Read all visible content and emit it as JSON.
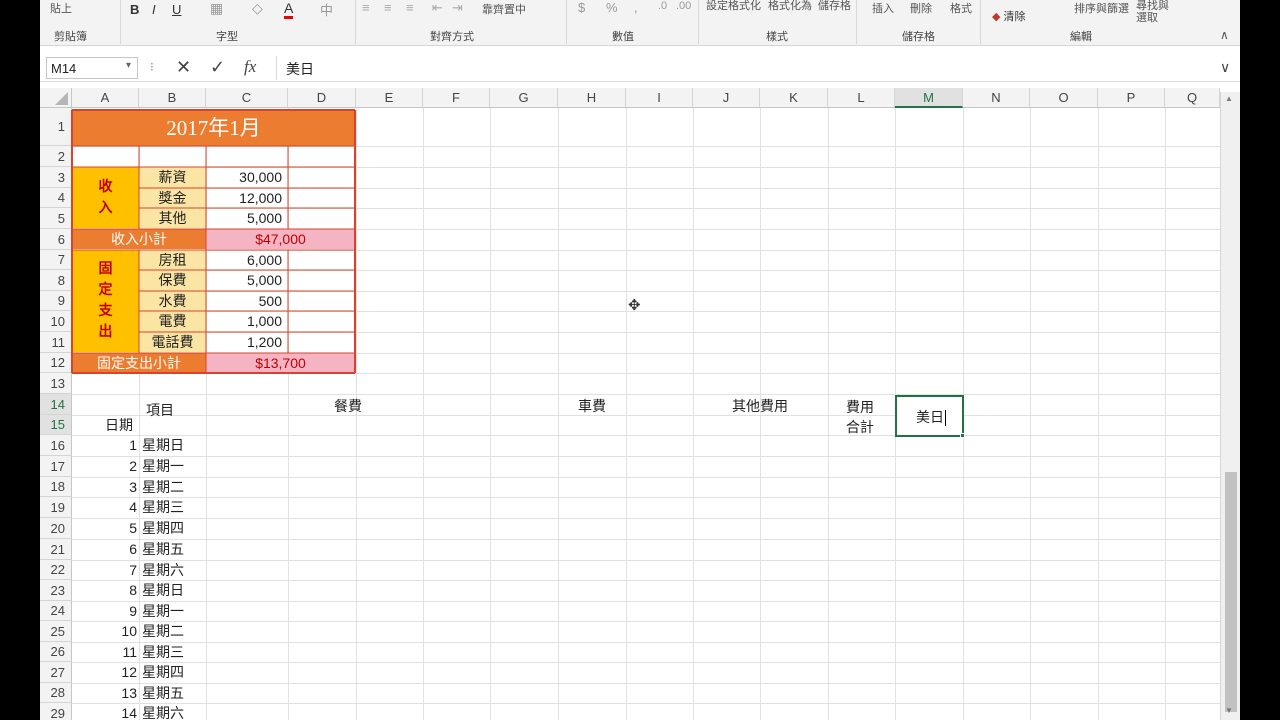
{
  "ribbon": {
    "top_items": [
      "貼上",
      "B",
      "I",
      "U",
      "A",
      "靠齊置中",
      "$",
      "%",
      "設定格式化",
      "格式化為",
      "儲存格",
      "插入",
      "刪除",
      "格式",
      "清除",
      "排序與篩選",
      "尋找與選取"
    ],
    "groups": [
      "剪貼簿",
      "字型",
      "對齊方式",
      "數值",
      "樣式",
      "儲存格",
      "編輯"
    ]
  },
  "formula_bar": {
    "name_box": "M14",
    "cancel": "✕",
    "enter": "✓",
    "fx": "fx",
    "content": "美日"
  },
  "columns": [
    "A",
    "B",
    "C",
    "D",
    "E",
    "F",
    "G",
    "H",
    "I",
    "J",
    "K",
    "L",
    "M",
    "N",
    "O",
    "P",
    "Q"
  ],
  "rows": [
    "1",
    "2",
    "3",
    "4",
    "5",
    "6",
    "7",
    "8",
    "9",
    "10",
    "11",
    "12",
    "13",
    "14",
    "15",
    "16",
    "17",
    "18",
    "19",
    "20",
    "21",
    "22",
    "23",
    "24",
    "25",
    "26",
    "27",
    "28",
    "29"
  ],
  "budget": {
    "title": "2017年1月",
    "income_label": "收入",
    "income": [
      {
        "item": "薪資",
        "amount": "30,000"
      },
      {
        "item": "獎金",
        "amount": "12,000"
      },
      {
        "item": "其他",
        "amount": "5,000"
      }
    ],
    "income_subtotal_label": "收入小計",
    "income_subtotal": "$47,000",
    "fixed_label": "固定支出",
    "fixed": [
      {
        "item": "房租",
        "amount": "6,000"
      },
      {
        "item": "保費",
        "amount": "5,000"
      },
      {
        "item": "水費",
        "amount": "500"
      },
      {
        "item": "電費",
        "amount": "1,000"
      },
      {
        "item": "電話費",
        "amount": "1,200"
      }
    ],
    "fixed_subtotal_label": "固定支出小計",
    "fixed_subtotal": "$13,700"
  },
  "daily": {
    "hdr_item": "項目",
    "hdr_date": "日期",
    "hdr_meal": "餐費",
    "hdr_car": "車費",
    "hdr_other": "其他費用",
    "hdr_total_1": "費用",
    "hdr_total_2": "合計",
    "editing": "美日",
    "rows": [
      {
        "n": "1",
        "d": "星期日"
      },
      {
        "n": "2",
        "d": "星期一"
      },
      {
        "n": "3",
        "d": "星期二"
      },
      {
        "n": "4",
        "d": "星期三"
      },
      {
        "n": "5",
        "d": "星期四"
      },
      {
        "n": "6",
        "d": "星期五"
      },
      {
        "n": "7",
        "d": "星期六"
      },
      {
        "n": "8",
        "d": "星期日"
      },
      {
        "n": "9",
        "d": "星期一"
      },
      {
        "n": "10",
        "d": "星期二"
      },
      {
        "n": "11",
        "d": "星期三"
      },
      {
        "n": "12",
        "d": "星期四"
      },
      {
        "n": "13",
        "d": "星期五"
      },
      {
        "n": "14",
        "d": "星期六"
      }
    ]
  }
}
